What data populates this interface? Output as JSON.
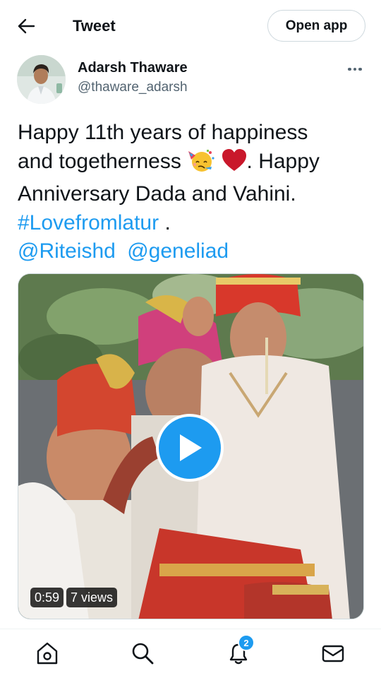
{
  "header": {
    "title": "Tweet",
    "open_app_label": "Open app"
  },
  "author": {
    "name": "Adarsh Thaware",
    "handle": "@thaware_adarsh"
  },
  "tweet": {
    "line1": "Happy 11th years of happiness",
    "line2_text": "and togetherness",
    "line2_tail": ". Happy",
    "line3": "Anniversary Dada and Vahini.",
    "hashtag": "#Lovefromlatur",
    "hashtag_tail": " .",
    "mention1": "@Riteishd",
    "mention2": "@geneliad",
    "emojis": [
      "party-face-emoji",
      "red-heart-emoji"
    ]
  },
  "media": {
    "duration": "0:59",
    "views": "7 views"
  },
  "nav": {
    "items": [
      "home-icon",
      "search-icon",
      "notifications-icon",
      "messages-icon"
    ],
    "notification_count": "2"
  },
  "colors": {
    "accent": "#1d9bf0",
    "text": "#0f1419",
    "secondary": "#536471"
  }
}
